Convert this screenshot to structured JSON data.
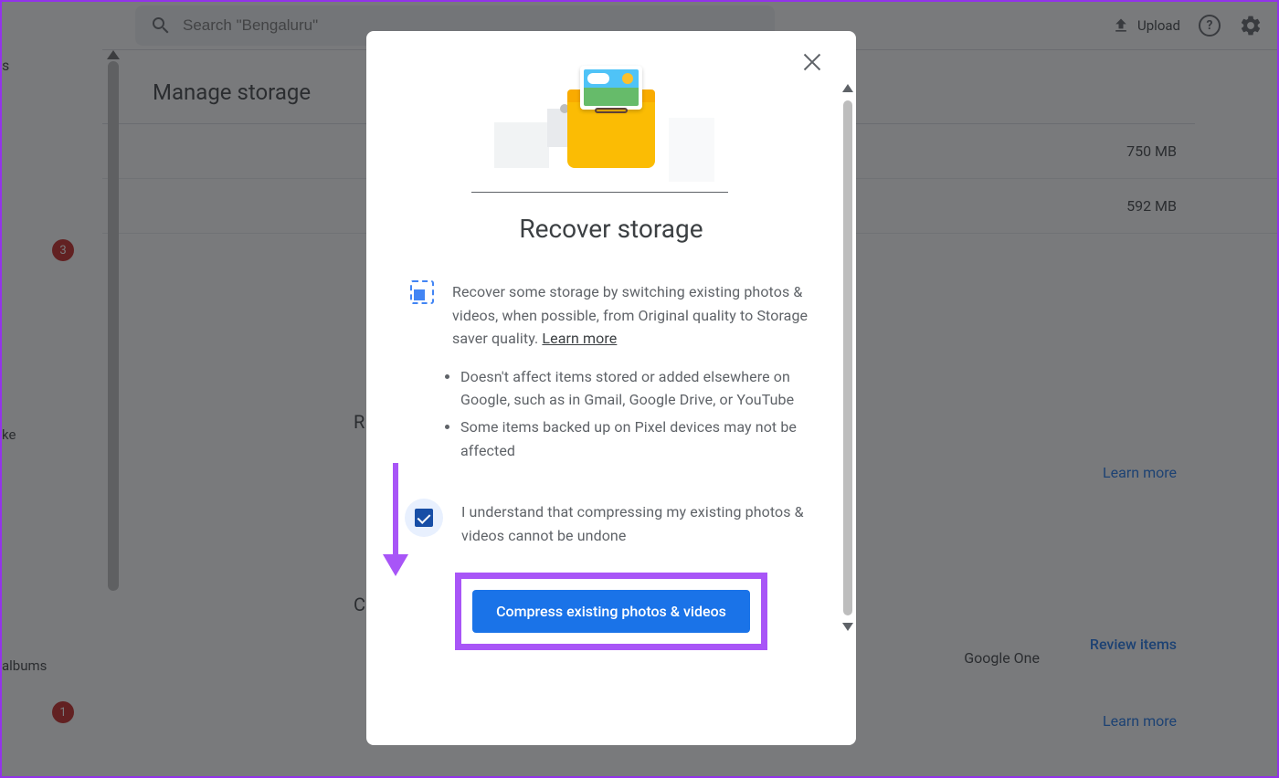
{
  "header": {
    "search_placeholder": "Search \"Bengaluru\"",
    "upload_label": "Upload"
  },
  "sidebar": {
    "badge3": "3",
    "badge1": "1",
    "item_s": "s",
    "item_ke": "ke",
    "item_albums": "albums"
  },
  "main": {
    "title": "Manage storage",
    "rows": [
      {
        "size": "750 MB"
      },
      {
        "size": "592 MB"
      }
    ],
    "section_r": "R",
    "section_c": "C",
    "learn_more": "Learn more",
    "review_items": "Review items",
    "google_one": "Google One"
  },
  "modal": {
    "title": "Recover storage",
    "description": "Recover some storage by switching existing photos & videos, when possible, from Original quality to Storage saver quality. ",
    "learn_more": "Learn more",
    "bullets": [
      "Doesn't affect items stored or added elsewhere on Google, such as in Gmail, Google Drive, or YouTube",
      "Some items backed up on Pixel devices may not be affected"
    ],
    "consent": "I understand that compressing my existing photos & videos cannot be undone",
    "compress_button": "Compress existing photos & videos"
  }
}
